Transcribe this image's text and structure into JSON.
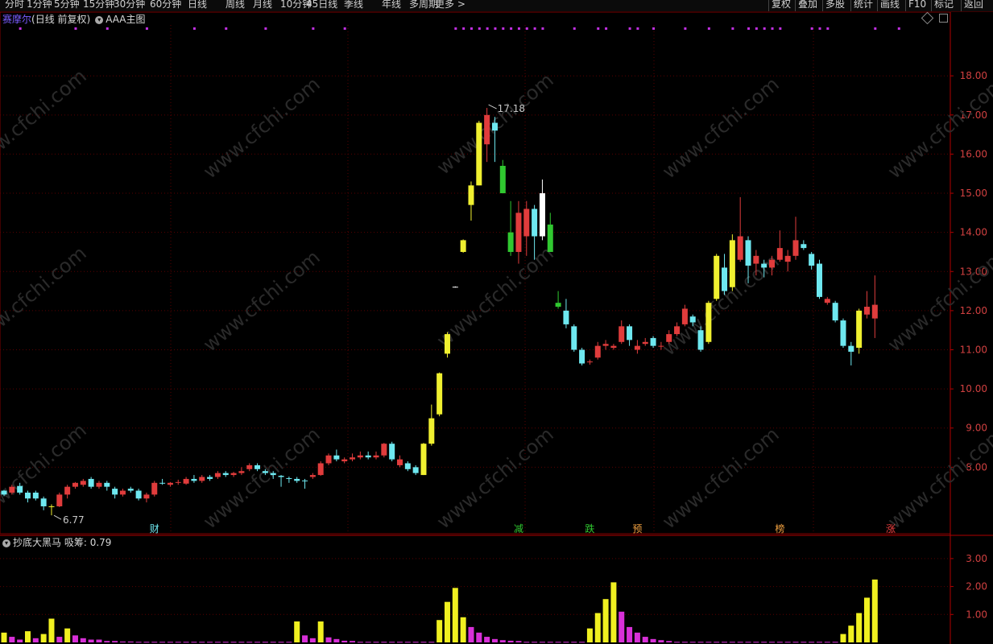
{
  "toolbar": {
    "periods": [
      "分时",
      "1分钟",
      "5分钟",
      "15分钟",
      "30分钟",
      "60分钟",
      "日线",
      "周线",
      "月线",
      "10分钟",
      "45日线",
      "季线",
      "年线",
      "多周期",
      "更多 >"
    ],
    "right_buttons": [
      "复权",
      "叠加",
      "多股",
      "统计",
      "画线",
      "F10",
      "标记",
      "返回"
    ]
  },
  "header": {
    "stock_name": "赛摩尔",
    "period_label": "(日线 前复权)",
    "indicator_name": "AAA主图"
  },
  "price_axis": {
    "ticks": [
      "18.00",
      "17.00",
      "16.00",
      "15.00",
      "14.00",
      "13.00",
      "12.00",
      "11.00",
      "10.00",
      "9.00",
      "8.00"
    ]
  },
  "annotations": {
    "high_label": "17.18",
    "low_label": "6.77",
    "event_markers": [
      "财",
      "减",
      "跌",
      "预",
      "榜",
      "涨"
    ]
  },
  "sub_chart": {
    "indicator_name": "抄底大黑马",
    "value_label": "吸筹:",
    "value": "0.79",
    "ticks": [
      "3.00",
      "2.00",
      "1.00"
    ]
  },
  "watermark": "www.cfchi.com",
  "colors": {
    "background": "#000000",
    "up_candle": "#e03c3c",
    "down_candle": "#6ee8f0",
    "yellow_candle": "#f0f030",
    "green_candle": "#30c830",
    "sub_yellow": "#f0f020",
    "sub_magenta": "#d830d8",
    "grid": "#5a0000",
    "axis_text": "#d04040"
  },
  "chart_data": {
    "type": "candlestick",
    "y_range": [
      6.3,
      19.3
    ],
    "candles": [
      [
        7.3,
        7.4,
        7.42,
        7.26,
        "c"
      ],
      [
        7.35,
        7.5,
        7.55,
        7.3,
        "r"
      ],
      [
        7.52,
        7.35,
        7.6,
        7.3,
        "c"
      ],
      [
        7.35,
        7.2,
        7.4,
        7.1,
        "c"
      ],
      [
        7.2,
        7.35,
        7.4,
        7.15,
        "c"
      ],
      [
        7.2,
        7.0,
        7.25,
        6.9,
        "c"
      ],
      [
        7.0,
        6.98,
        7.05,
        6.77,
        "y"
      ],
      [
        7.0,
        7.3,
        7.35,
        6.98,
        "r"
      ],
      [
        7.3,
        7.5,
        7.55,
        7.2,
        "r"
      ],
      [
        7.5,
        7.6,
        7.62,
        7.45,
        "r"
      ],
      [
        7.55,
        7.65,
        7.7,
        7.5,
        "r"
      ],
      [
        7.7,
        7.5,
        7.75,
        7.45,
        "c"
      ],
      [
        7.5,
        7.6,
        7.65,
        7.45,
        "r"
      ],
      [
        7.6,
        7.5,
        7.65,
        7.4,
        "c"
      ],
      [
        7.45,
        7.3,
        7.5,
        7.2,
        "c"
      ],
      [
        7.3,
        7.4,
        7.45,
        7.25,
        "r"
      ],
      [
        7.45,
        7.4,
        7.5,
        7.35,
        "c"
      ],
      [
        7.4,
        7.2,
        7.45,
        7.15,
        "c"
      ],
      [
        7.2,
        7.3,
        7.35,
        7.1,
        "r"
      ],
      [
        7.3,
        7.6,
        7.65,
        7.25,
        "r"
      ],
      [
        7.6,
        7.6,
        7.7,
        7.55,
        "c"
      ],
      [
        7.55,
        7.6,
        7.62,
        7.5,
        "r"
      ],
      [
        7.6,
        7.62,
        7.68,
        7.55,
        "r"
      ],
      [
        7.58,
        7.7,
        7.75,
        7.55,
        "r"
      ],
      [
        7.65,
        7.7,
        7.8,
        7.6,
        "c"
      ],
      [
        7.65,
        7.75,
        7.8,
        7.6,
        "r"
      ],
      [
        7.7,
        7.75,
        7.8,
        7.65,
        "c"
      ],
      [
        7.75,
        7.85,
        7.9,
        7.7,
        "r"
      ],
      [
        7.85,
        7.8,
        7.9,
        7.75,
        "c"
      ],
      [
        7.8,
        7.85,
        7.88,
        7.75,
        "r"
      ],
      [
        7.85,
        7.9,
        8.0,
        7.8,
        "r"
      ],
      [
        7.95,
        8.05,
        8.1,
        7.9,
        "r"
      ],
      [
        8.05,
        7.95,
        8.1,
        7.9,
        "c"
      ],
      [
        7.9,
        7.85,
        7.95,
        7.8,
        "c"
      ],
      [
        7.85,
        7.8,
        7.9,
        7.7,
        "c"
      ],
      [
        7.75,
        7.78,
        7.8,
        7.5,
        "c"
      ],
      [
        7.7,
        7.72,
        7.76,
        7.6,
        "c"
      ],
      [
        7.7,
        7.65,
        7.75,
        7.6,
        "c"
      ],
      [
        7.65,
        7.66,
        7.7,
        7.45,
        "c"
      ],
      [
        7.75,
        7.8,
        7.85,
        7.7,
        "r"
      ],
      [
        7.8,
        8.1,
        8.15,
        7.78,
        "r"
      ],
      [
        8.1,
        8.3,
        8.35,
        8.05,
        "r"
      ],
      [
        8.3,
        8.2,
        8.45,
        8.15,
        "c"
      ],
      [
        8.15,
        8.2,
        8.25,
        8.1,
        "r"
      ],
      [
        8.2,
        8.25,
        8.35,
        8.15,
        "r"
      ],
      [
        8.25,
        8.3,
        8.4,
        8.2,
        "r"
      ],
      [
        8.3,
        8.25,
        8.4,
        8.2,
        "c"
      ],
      [
        8.25,
        8.3,
        8.4,
        8.2,
        "r"
      ],
      [
        8.3,
        8.6,
        8.62,
        8.25,
        "r"
      ],
      [
        8.6,
        8.2,
        8.65,
        8.15,
        "c"
      ],
      [
        8.2,
        8.05,
        8.3,
        8.0,
        "r"
      ],
      [
        8.1,
        7.95,
        8.15,
        7.9,
        "c"
      ],
      [
        8.0,
        7.85,
        8.05,
        7.8,
        "c"
      ],
      [
        7.8,
        8.6,
        8.62,
        7.8,
        "y"
      ],
      [
        8.6,
        9.25,
        9.6,
        8.55,
        "y"
      ],
      [
        9.35,
        10.4,
        10.42,
        9.3,
        "y"
      ],
      [
        10.9,
        11.4,
        11.45,
        10.8,
        "y"
      ],
      [
        12.6,
        12.61,
        12.62,
        12.59,
        "w"
      ],
      [
        13.5,
        13.8,
        13.82,
        13.48,
        "y"
      ],
      [
        14.7,
        15.2,
        15.3,
        14.3,
        "y"
      ],
      [
        15.2,
        16.8,
        16.85,
        15.2,
        "y"
      ],
      [
        17.0,
        16.25,
        17.18,
        15.8,
        "r"
      ],
      [
        16.6,
        16.8,
        16.95,
        15.8,
        "c"
      ],
      [
        15.7,
        15.0,
        15.85,
        15.0,
        "g"
      ],
      [
        14.0,
        13.5,
        14.8,
        13.4,
        "g"
      ],
      [
        13.5,
        14.5,
        14.8,
        13.2,
        "r"
      ],
      [
        13.9,
        14.6,
        14.8,
        13.4,
        "r"
      ],
      [
        14.6,
        13.9,
        14.7,
        13.3,
        "c"
      ],
      [
        13.9,
        15.0,
        15.35,
        13.8,
        "w"
      ],
      [
        14.2,
        13.5,
        14.5,
        13.5,
        "g"
      ],
      [
        12.2,
        12.1,
        12.5,
        12.05,
        "g"
      ],
      [
        12.0,
        11.65,
        12.3,
        11.55,
        "c"
      ],
      [
        11.6,
        11.0,
        11.65,
        10.95,
        "c"
      ],
      [
        11.0,
        10.65,
        11.05,
        10.6,
        "c"
      ],
      [
        10.7,
        10.68,
        10.75,
        10.62,
        "r"
      ],
      [
        10.8,
        11.1,
        11.2,
        10.75,
        "r"
      ],
      [
        11.1,
        11.15,
        11.25,
        11.0,
        "r"
      ],
      [
        11.05,
        11.1,
        11.15,
        11.0,
        "r"
      ],
      [
        11.2,
        11.6,
        11.75,
        11.15,
        "r"
      ],
      [
        11.6,
        11.25,
        11.65,
        11.1,
        "c"
      ],
      [
        11.0,
        11.1,
        11.25,
        10.9,
        "r"
      ],
      [
        11.15,
        11.2,
        11.3,
        11.1,
        "r"
      ],
      [
        11.3,
        11.1,
        11.35,
        11.05,
        "c"
      ],
      [
        11.1,
        11.1,
        11.2,
        11.0,
        "r"
      ],
      [
        11.2,
        11.4,
        11.5,
        11.15,
        "r"
      ],
      [
        11.4,
        11.6,
        11.7,
        11.35,
        "r"
      ],
      [
        11.65,
        12.05,
        12.15,
        11.6,
        "r"
      ],
      [
        11.85,
        11.7,
        11.9,
        11.6,
        "c"
      ],
      [
        11.5,
        11.0,
        11.6,
        10.95,
        "c"
      ],
      [
        11.2,
        12.2,
        12.25,
        11.15,
        "y"
      ],
      [
        12.3,
        13.4,
        13.45,
        12.25,
        "y"
      ],
      [
        12.5,
        13.1,
        13.45,
        12.4,
        "c"
      ],
      [
        12.6,
        13.8,
        13.95,
        12.5,
        "y"
      ],
      [
        13.3,
        13.9,
        14.9,
        13.25,
        "r"
      ],
      [
        13.8,
        13.15,
        13.9,
        12.7,
        "c"
      ],
      [
        13.2,
        13.4,
        13.55,
        12.9,
        "r"
      ],
      [
        13.2,
        13.1,
        13.3,
        12.85,
        "c"
      ],
      [
        13.1,
        13.3,
        13.4,
        12.9,
        "r"
      ],
      [
        13.3,
        13.6,
        14.05,
        13.25,
        "r"
      ],
      [
        13.25,
        13.4,
        13.55,
        13.0,
        "r"
      ],
      [
        13.4,
        13.8,
        14.4,
        13.3,
        "r"
      ],
      [
        13.7,
        13.6,
        13.8,
        13.55,
        "c"
      ],
      [
        13.45,
        13.15,
        13.5,
        13.05,
        "c"
      ],
      [
        13.2,
        12.35,
        13.3,
        12.3,
        "c"
      ],
      [
        12.3,
        12.2,
        12.35,
        12.15,
        "r"
      ],
      [
        12.2,
        11.75,
        12.25,
        11.7,
        "c"
      ],
      [
        11.75,
        11.1,
        11.8,
        11.05,
        "c"
      ],
      [
        11.1,
        10.95,
        11.2,
        10.6,
        "c"
      ],
      [
        11.05,
        12.0,
        12.05,
        10.9,
        "y"
      ],
      [
        11.9,
        12.1,
        12.5,
        11.8,
        "r"
      ],
      [
        12.15,
        11.8,
        12.9,
        11.3,
        "r"
      ]
    ],
    "sub_bars": [
      [
        0.35,
        "y"
      ],
      [
        0.2,
        "m"
      ],
      [
        0.1,
        "m"
      ],
      [
        0.4,
        "y"
      ],
      [
        0.15,
        "m"
      ],
      [
        0.3,
        "y"
      ],
      [
        0.85,
        "y"
      ],
      [
        0.2,
        "m"
      ],
      [
        0.5,
        "y"
      ],
      [
        0.25,
        "m"
      ],
      [
        0.15,
        "m"
      ],
      [
        0.1,
        "m"
      ],
      [
        0.1,
        "m"
      ],
      [
        0.05,
        "m"
      ],
      [
        0.05,
        "m"
      ],
      [
        0.03,
        "m"
      ],
      [
        0.03,
        "m"
      ],
      [
        0.02,
        "m"
      ],
      [
        0.02,
        "m"
      ],
      [
        0.02,
        "m"
      ],
      [
        0.02,
        "m"
      ],
      [
        0.02,
        "m"
      ],
      [
        0.02,
        "m"
      ],
      [
        0.02,
        "m"
      ],
      [
        0.02,
        "m"
      ],
      [
        0.02,
        "m"
      ],
      [
        0.02,
        "m"
      ],
      [
        0.02,
        "m"
      ],
      [
        0.02,
        "m"
      ],
      [
        0.02,
        "m"
      ],
      [
        0.02,
        "m"
      ],
      [
        0.02,
        "m"
      ],
      [
        0.02,
        "m"
      ],
      [
        0.02,
        "m"
      ],
      [
        0.02,
        "m"
      ],
      [
        0.02,
        "m"
      ],
      [
        0.02,
        "m"
      ],
      [
        0.02,
        "m"
      ],
      [
        0.02,
        "m"
      ],
      [
        0.02,
        "m"
      ],
      [
        0.02,
        "m"
      ],
      [
        0.02,
        "m"
      ],
      [
        0.02,
        "m"
      ],
      [
        0.02,
        "m"
      ],
      [
        0.02,
        "m"
      ],
      [
        0.02,
        "m"
      ],
      [
        0.02,
        "m"
      ],
      [
        0.02,
        "m"
      ],
      [
        0.02,
        "m"
      ],
      [
        0.02,
        "m"
      ],
      [
        0.02,
        "m"
      ],
      [
        0.02,
        "m"
      ],
      [
        0.02,
        "m"
      ],
      [
        0.02,
        "m"
      ],
      [
        0.02,
        "m"
      ],
      [
        0.02,
        "m"
      ],
      [
        0.02,
        "m"
      ],
      [
        0.02,
        "m"
      ],
      [
        0.02,
        "m"
      ],
      [
        0.02,
        "m"
      ],
      [
        0.02,
        "m"
      ],
      [
        0.02,
        "m"
      ],
      [
        0.02,
        "m"
      ],
      [
        0.02,
        "m"
      ],
      [
        0.02,
        "m"
      ],
      [
        0.02,
        "m"
      ],
      [
        0.02,
        "m"
      ],
      [
        0.02,
        "m"
      ],
      [
        0.02,
        "m"
      ],
      [
        0.02,
        "m"
      ],
      [
        0.02,
        "m"
      ],
      [
        0.02,
        "m"
      ],
      [
        0.02,
        "m"
      ],
      [
        0.02,
        "m"
      ],
      [
        0.02,
        "m"
      ],
      [
        0.02,
        "m"
      ],
      [
        0.02,
        "m"
      ],
      [
        0.02,
        "m"
      ],
      [
        0.02,
        "m"
      ],
      [
        0.02,
        "m"
      ],
      [
        0.02,
        "m"
      ],
      [
        0.02,
        "m"
      ],
      [
        0.02,
        "m"
      ],
      [
        0.02,
        "m"
      ],
      [
        0.02,
        "m"
      ],
      [
        0.02,
        "m"
      ],
      [
        0.02,
        "m"
      ],
      [
        0.02,
        "m"
      ],
      [
        0.02,
        "m"
      ],
      [
        0.02,
        "m"
      ],
      [
        0.02,
        "m"
      ],
      [
        0.02,
        "m"
      ],
      [
        0.02,
        "m"
      ],
      [
        0.02,
        "m"
      ],
      [
        0.02,
        "m"
      ],
      [
        0.02,
        "m"
      ],
      [
        0.02,
        "m"
      ],
      [
        0.02,
        "m"
      ],
      [
        0.02,
        "m"
      ],
      [
        0.02,
        "m"
      ],
      [
        0.02,
        "m"
      ],
      [
        0.02,
        "m"
      ],
      [
        0.02,
        "m"
      ],
      [
        0.02,
        "m"
      ],
      [
        0.02,
        "m"
      ],
      [
        0.02,
        "m"
      ],
      [
        0.02,
        "m"
      ],
      [
        0.02,
        "m"
      ],
      [
        0.02,
        "m"
      ],
      [
        0.02,
        "m"
      ],
      [
        0.02,
        "m"
      ]
    ],
    "sub_bar_overrides": [
      [
        37,
        0.75,
        "y"
      ],
      [
        38,
        0.25,
        "m"
      ],
      [
        39,
        0.15,
        "m"
      ],
      [
        40,
        0.75,
        "y"
      ],
      [
        41,
        0.18,
        "m"
      ],
      [
        42,
        0.12,
        "m"
      ],
      [
        43,
        0.06,
        "m"
      ],
      [
        44,
        0.05,
        "m"
      ],
      [
        55,
        0.8,
        "y"
      ],
      [
        56,
        1.45,
        "y"
      ],
      [
        57,
        1.95,
        "y"
      ],
      [
        58,
        0.9,
        "y"
      ],
      [
        59,
        0.55,
        "m"
      ],
      [
        60,
        0.35,
        "m"
      ],
      [
        61,
        0.2,
        "m"
      ],
      [
        62,
        0.12,
        "m"
      ],
      [
        63,
        0.08,
        "m"
      ],
      [
        64,
        0.06,
        "m"
      ],
      [
        65,
        0.05,
        "m"
      ],
      [
        74,
        0.5,
        "y"
      ],
      [
        75,
        1.05,
        "y"
      ],
      [
        76,
        1.55,
        "y"
      ],
      [
        77,
        2.15,
        "y"
      ],
      [
        78,
        1.1,
        "m"
      ],
      [
        79,
        0.55,
        "m"
      ],
      [
        80,
        0.35,
        "m"
      ],
      [
        81,
        0.2,
        "m"
      ],
      [
        82,
        0.12,
        "m"
      ],
      [
        83,
        0.08,
        "m"
      ],
      [
        84,
        0.05,
        "m"
      ],
      [
        106,
        0.3,
        "y"
      ],
      [
        107,
        0.6,
        "y"
      ],
      [
        108,
        1.05,
        "y"
      ],
      [
        109,
        1.6,
        "y"
      ],
      [
        110,
        2.25,
        "y"
      ],
      [
        111,
        3.15,
        "y"
      ],
      [
        112,
        1.6,
        "m"
      ],
      [
        113,
        0.79,
        "m"
      ]
    ],
    "sub_y_range": [
      0,
      3.4
    ],
    "event_positions": [
      19,
      65,
      74,
      80,
      98,
      112
    ],
    "high_index": 61,
    "low_index": 6,
    "top_dot_groups": [
      [
        2,
        9,
        13,
        18
      ],
      [
        24,
        28,
        33,
        39,
        43
      ],
      [
        57,
        58,
        59,
        60,
        61,
        62,
        63,
        64,
        65,
        66,
        67,
        68
      ],
      [
        72,
        75,
        76
      ],
      [
        79,
        80,
        82
      ],
      [
        86,
        89,
        92
      ],
      [
        94,
        95,
        96,
        97,
        98
      ],
      [
        102,
        103,
        104
      ],
      [
        110,
        113
      ]
    ]
  }
}
